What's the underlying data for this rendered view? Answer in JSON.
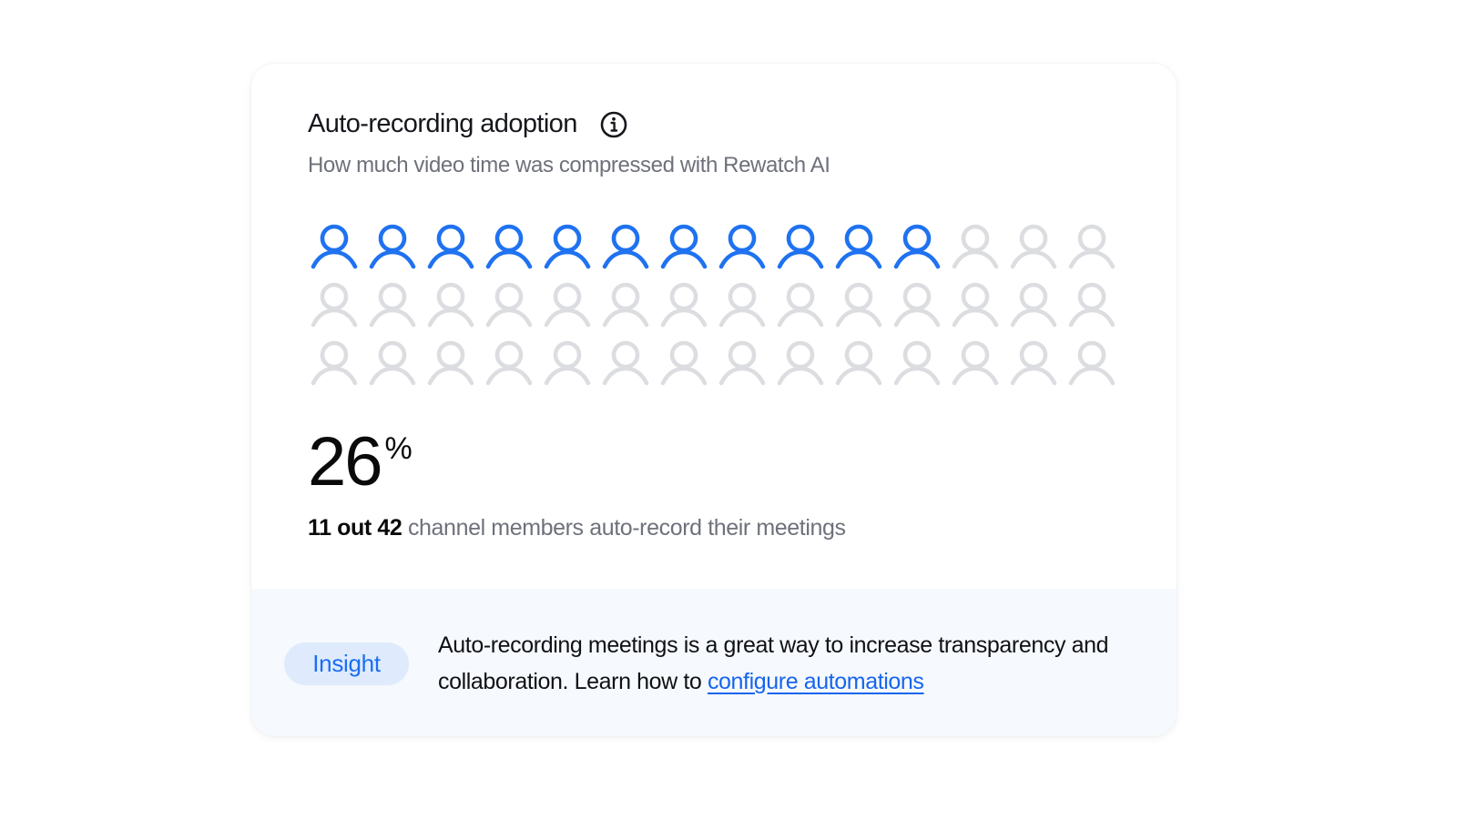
{
  "card": {
    "title": "Auto-recording adoption",
    "title_icon": "info-icon",
    "subtitle": "How much video time was compressed with Rewatch AI"
  },
  "adoption": {
    "active_count": 11,
    "total_count": 42,
    "icon": "person-icon",
    "active_color": "#1f72f0",
    "inactive_color": "#dcdde0"
  },
  "stat": {
    "value": "26",
    "unit": "%",
    "desc_strong": "11 out 42",
    "desc_rest": " channel members auto-record their meetings"
  },
  "insight": {
    "badge_label": "Insight",
    "text": "Auto-recording meetings is a great way to increase transparency and collaboration. Learn how to ",
    "link_text": "configure automations"
  }
}
